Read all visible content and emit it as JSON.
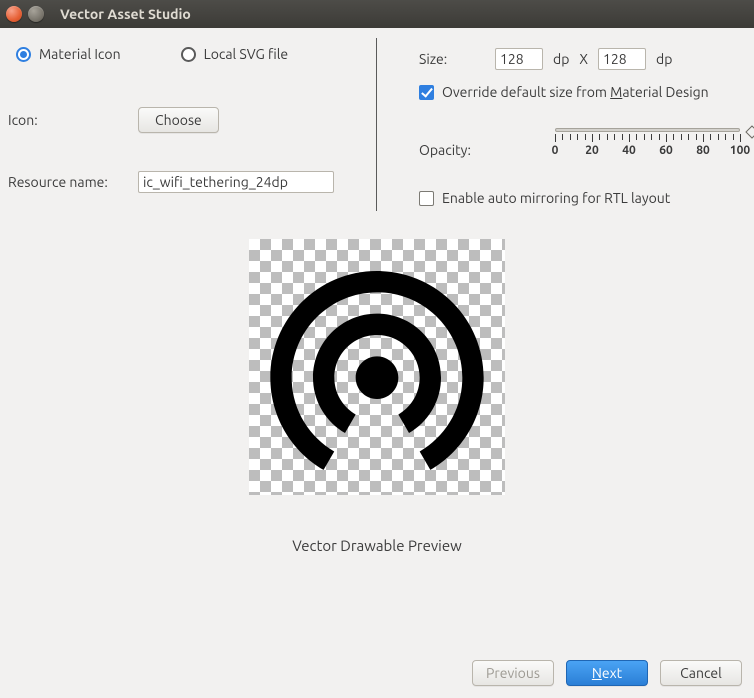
{
  "window": {
    "title": "Vector Asset Studio"
  },
  "source": {
    "material_label": "Material Icon",
    "svg_label": "Local SVG file",
    "selected": "material"
  },
  "icon": {
    "label": "Icon:",
    "choose_label": "Choose"
  },
  "resource": {
    "label": "Resource name:",
    "value": "ic_wifi_tethering_24dp"
  },
  "size": {
    "label": "Size:",
    "width": "128",
    "height": "128",
    "sep": "X",
    "unit": "dp"
  },
  "override": {
    "label_pre": "Override default size from ",
    "label_m": "M",
    "label_post": "aterial Design",
    "checked": true
  },
  "opacity": {
    "label": "Opacity:",
    "value": 100,
    "ticks": [
      "0",
      "20",
      "40",
      "60",
      "80",
      "100"
    ]
  },
  "rtl": {
    "label": "Enable auto mirroring for RTL layout",
    "checked": false
  },
  "preview": {
    "caption": "Vector Drawable Preview",
    "icon_name": "wifi-tethering-icon"
  },
  "footer": {
    "previous": "Previous",
    "next_prefix": "N",
    "next_rest": "ext",
    "cancel": "Cancel"
  }
}
